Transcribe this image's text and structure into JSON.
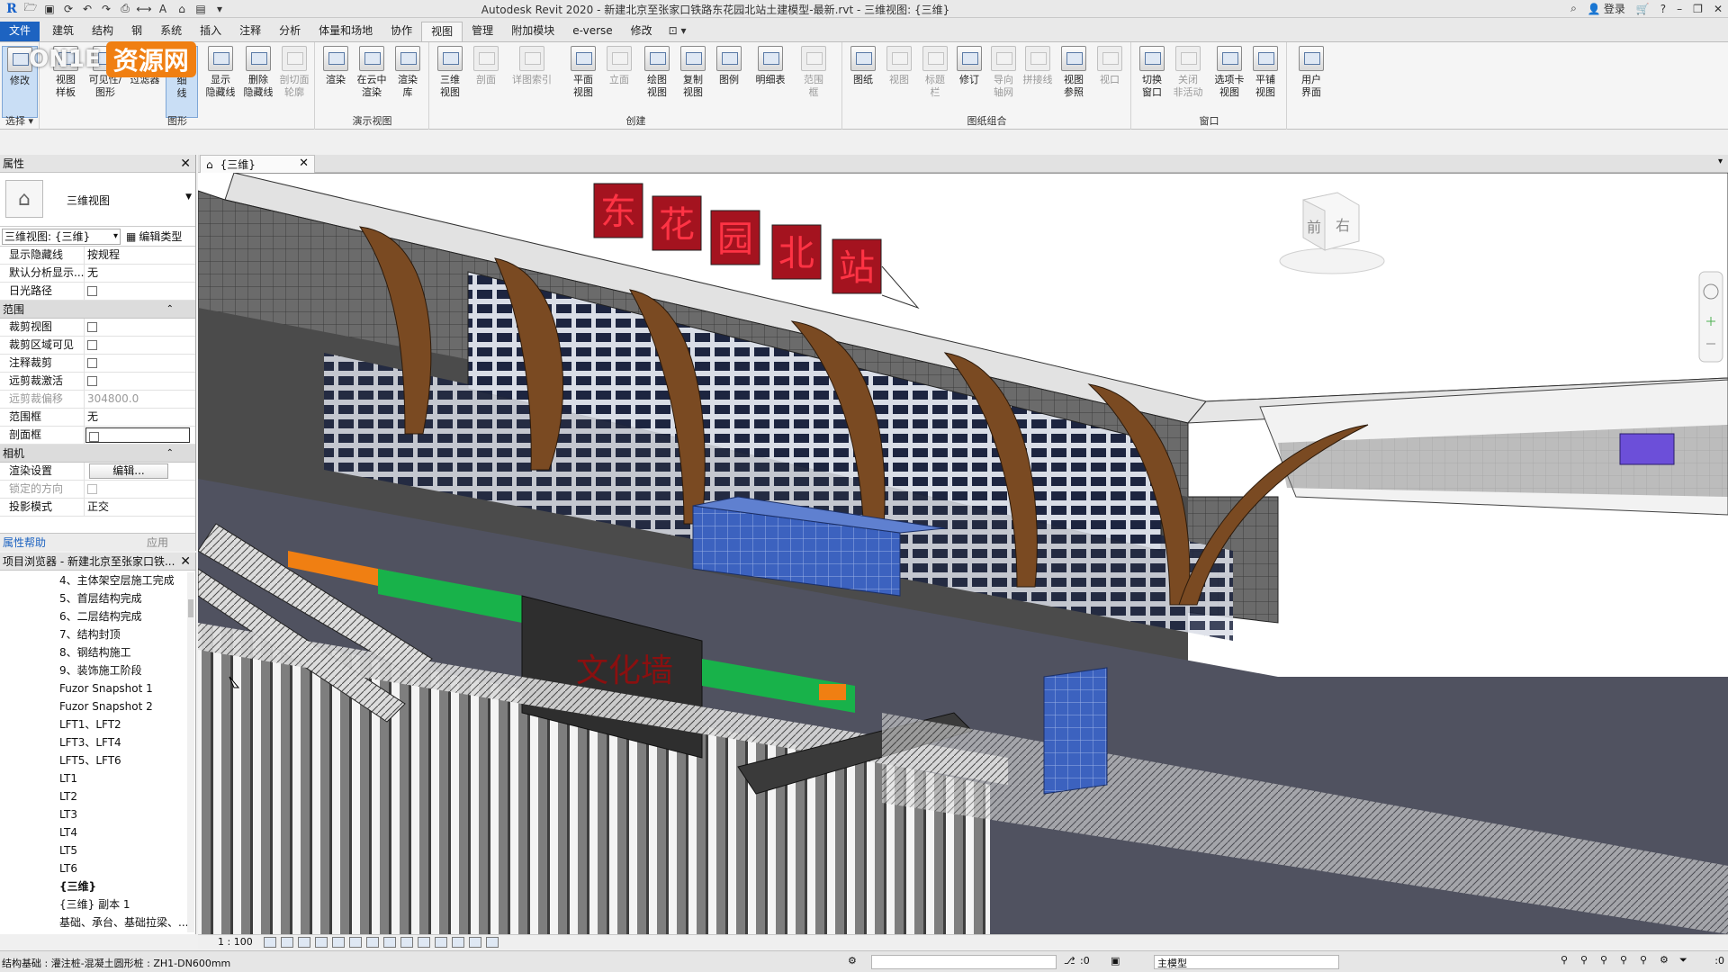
{
  "title": "Autodesk Revit 2020 - 新建北京至张家口铁路东花园北站土建模型-最新.rvt - 三维视图: {三维}",
  "login": "登录",
  "tabs": [
    "文件",
    "建筑",
    "结构",
    "钢",
    "系统",
    "插入",
    "注释",
    "分析",
    "体量和场地",
    "协作",
    "视图",
    "管理",
    "附加模块",
    "e-verse",
    "修改"
  ],
  "active_tab": "视图",
  "watermark": {
    "a": "ON1E",
    "b": "资源网"
  },
  "ribbon": {
    "modify": "修改",
    "select_group": "选择",
    "graphics": {
      "group": "图形",
      "buttons": [
        "视图\n样板",
        "可见性/\n图形",
        "过滤器",
        "细\n线",
        "显示\n隐藏线",
        "删除\n隐藏线",
        "剖切面\n轮廓"
      ]
    },
    "presentation": {
      "group": "演示视图",
      "buttons": [
        "渲染",
        "在云中\n渲染",
        "渲染\n库"
      ]
    },
    "create": {
      "group": "创建",
      "buttons": [
        "三维\n视图",
        "剖面",
        "详图索引",
        "平面\n视图",
        "立面",
        "绘图\n视图",
        "复制\n视图",
        "图例",
        "明细表",
        "范围\n框"
      ]
    },
    "sheet": {
      "group": "图纸组合",
      "buttons": [
        "图纸",
        "视图",
        "标题\n栏",
        "修订",
        "导向\n轴网",
        "拼接线",
        "视图\n参照",
        "视口"
      ]
    },
    "windows": {
      "group": "窗口",
      "buttons": [
        "切换\n窗口",
        "关闭\n非活动",
        "选项卡\n视图",
        "平铺\n视图",
        "用户\n界面"
      ]
    }
  },
  "properties": {
    "title": "属性",
    "type_name": "三维视图",
    "selector": "三维视图: {三维}",
    "edit_type": "编辑类型",
    "rows_top": [
      {
        "k": "显示隐藏线",
        "v": "按规程"
      },
      {
        "k": "默认分析显示...",
        "v": "无"
      },
      {
        "k": "日光路径",
        "v": ""
      }
    ],
    "section_extents": "范围",
    "rows_extents": [
      {
        "k": "裁剪视图",
        "v": ""
      },
      {
        "k": "裁剪区域可见",
        "v": ""
      },
      {
        "k": "注释裁剪",
        "v": ""
      },
      {
        "k": "远剪裁激活",
        "v": ""
      },
      {
        "k": "远剪裁偏移",
        "v": "304800.0"
      },
      {
        "k": "范围框",
        "v": "无"
      },
      {
        "k": "剖面框",
        "v": ""
      }
    ],
    "section_camera": "相机",
    "rows_camera": [
      {
        "k": "渲染设置",
        "v": "编辑..."
      },
      {
        "k": "锁定的方向",
        "v": ""
      },
      {
        "k": "投影模式",
        "v": "正交"
      }
    ],
    "help": "属性帮助",
    "apply": "应用"
  },
  "browser": {
    "title": "项目浏览器 - 新建北京至张家口铁...",
    "items": [
      "4、主体架空层施工完成",
      "5、首层结构完成",
      "6、二层结构完成",
      "7、结构封顶",
      "8、钢结构施工",
      "9、装饰施工阶段",
      "Fuzor Snapshot 1",
      "Fuzor Snapshot 2",
      "LFT1、LFT2",
      "LFT3、LFT4",
      "LFT5、LFT6",
      "LT1",
      "LT2",
      "LT3",
      "LT4",
      "LT5",
      "LT6",
      "{三维}",
      "{三维} 副本 1",
      "基础、承台、基础拉梁、..."
    ]
  },
  "view_tab": "{三维}",
  "viewcube": {
    "front": "前",
    "right": "右"
  },
  "sign_chars": [
    "东",
    "花",
    "园",
    "北",
    "站"
  ],
  "wall_text": "文化墙",
  "scale": "1 : 100",
  "status": {
    "message": "结构基础 : 灌注桩-混凝土圆形桩 : ZH1-DN600mm",
    "zero1": ":0",
    "model": "主模型",
    "filter": ":0"
  },
  "colors": {
    "accent": "#1d63c1",
    "sign": "#c8102e",
    "column": "#7a4a22",
    "glass": "#3b5fb5"
  }
}
